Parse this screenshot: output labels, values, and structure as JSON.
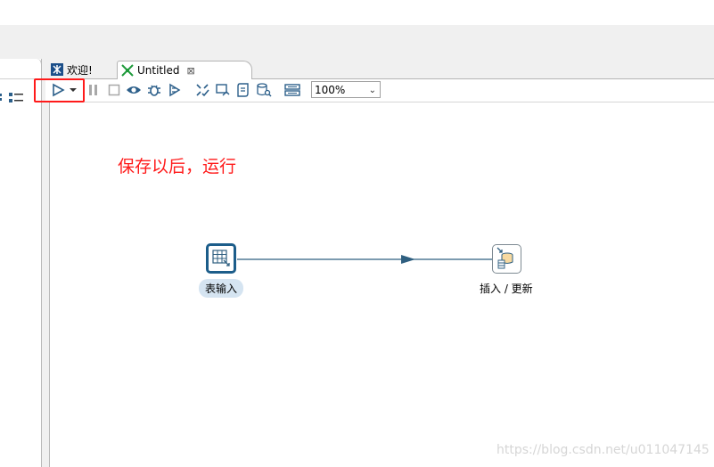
{
  "tabs": [
    {
      "label": "欢迎!"
    },
    {
      "label": "Untitled",
      "close": "⊠"
    }
  ],
  "toolbar": {
    "zoom_value": "100%"
  },
  "annotation": {
    "text": "保存以后，运行"
  },
  "steps": [
    {
      "label": "表输入"
    },
    {
      "label": "插入 / 更新"
    }
  ],
  "watermark": "https://blog.csdn.net/u011047145",
  "colors": {
    "accent": "#1c5d8a",
    "highlight": "#ff1a1a",
    "hop": "#2f5f80"
  }
}
